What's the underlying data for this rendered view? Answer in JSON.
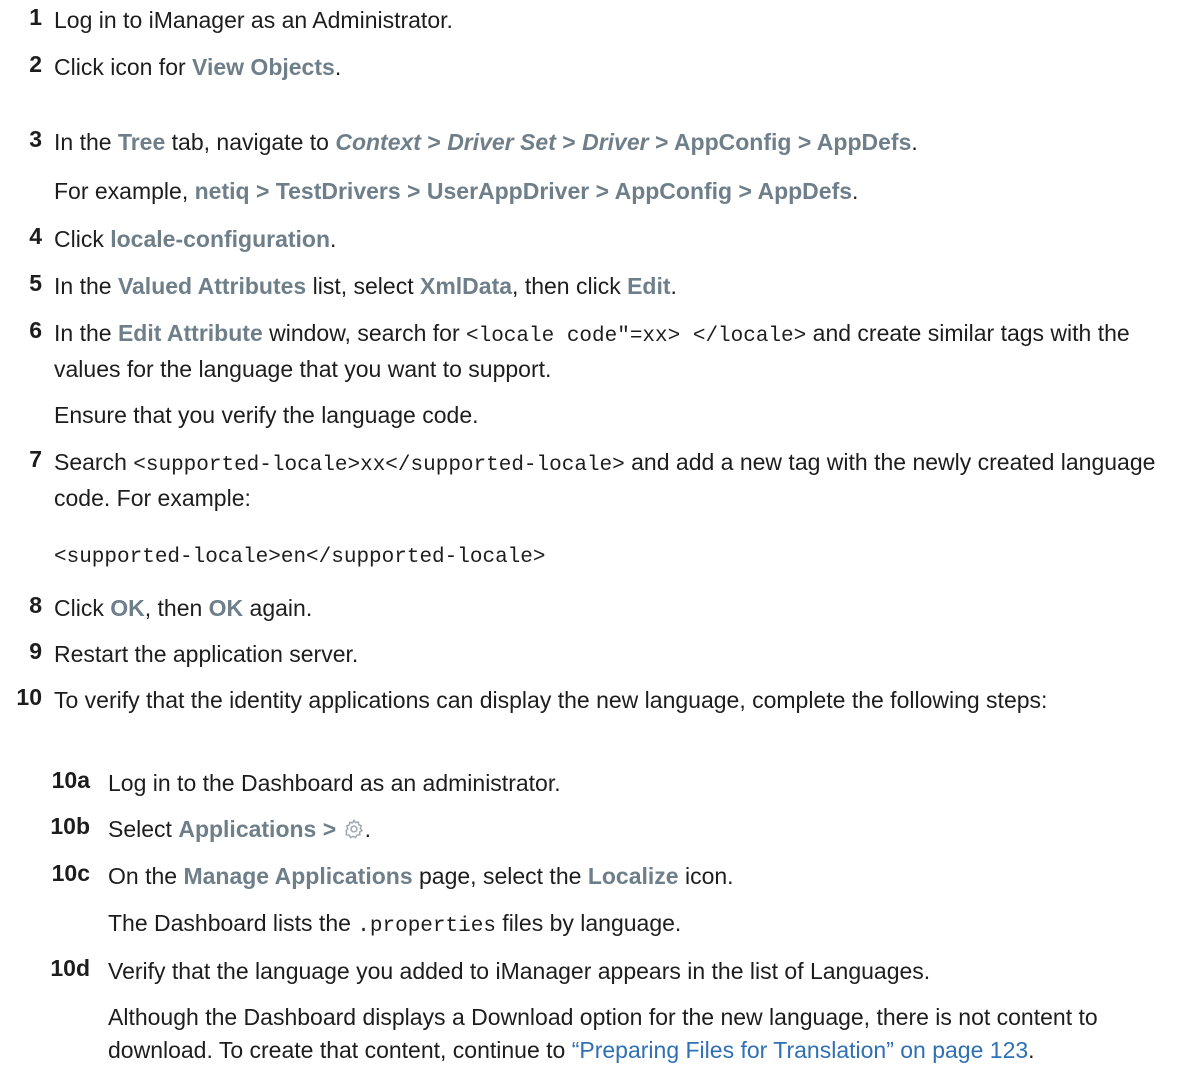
{
  "steps": [
    {
      "n": "1",
      "t0": "Log in to iManager as an Administrator."
    },
    {
      "n": "2",
      "t0": "Click icon for ",
      "ui0": "View Objects",
      "t1": "."
    },
    {
      "n": "3",
      "t0": "In the ",
      "ui0": "Tree",
      "t1": " tab, navigate to ",
      "it0": "Context",
      "s0": " > ",
      "it1": "Driver Set",
      "s1": " > ",
      "it2": "Driver",
      "s2": " > ",
      "ui1": "AppConfig",
      "s3": " > ",
      "ui2": "AppDefs",
      "t2": ".",
      "example_pre": "For example, ",
      "e0": "netiq",
      "e1": "TestDrivers",
      "e2": "UserAppDriver",
      "e3": "AppConfig",
      "e4": "AppDefs",
      "sep": " > ",
      "example_post": "."
    },
    {
      "n": "4",
      "t0": "Click ",
      "ui0": "locale-configuration",
      "t1": "."
    },
    {
      "n": "5",
      "t0": "In the ",
      "ui0": "Valued Attributes",
      "t1": " list, select ",
      "ui1": "XmlData",
      "t2": ", then click ",
      "ui2": "Edit",
      "t3": "."
    },
    {
      "n": "6",
      "t0": "In the ",
      "ui0": "Edit Attribute",
      "t1": " window, search for ",
      "code0": "<locale code\"=xx> </locale>",
      "t2": " and create similar tags with the values for the language that you want to support.",
      "note": "Ensure that you verify the language code."
    },
    {
      "n": "7",
      "t0": "Search ",
      "code0": "<supported-locale>xx</supported-locale>",
      "t1": " and add a new tag with the newly created language code. For example:",
      "code_block": "<supported-locale>en</supported-locale>"
    },
    {
      "n": "8",
      "t0": "Click ",
      "ui0": "OK",
      "t1": ", then ",
      "ui1": "OK",
      "t2": " again."
    },
    {
      "n": "9",
      "t0": "Restart the application server."
    },
    {
      "n": "10",
      "t0": "To verify that the identity applications can display the new language, complete the following steps:"
    }
  ],
  "substeps": [
    {
      "n": "10a",
      "t0": "Log in to the Dashboard as an administrator."
    },
    {
      "n": "10b",
      "t0": "Select ",
      "ui0": "Applications",
      "s0": " > ",
      "t1": "."
    },
    {
      "n": "10c",
      "t0": "On the ",
      "ui0": "Manage Applications",
      "t1": " page, select the ",
      "ui1": "Localize",
      "t2": " icon.",
      "note_pre": "The Dashboard lists the ",
      "note_code": ".properties",
      "note_post": " files by language."
    },
    {
      "n": "10d",
      "t0": "Verify that the language you added to iManager appears in the list of Languages.",
      "note": "Although the Dashboard displays a Download option for the new language, there is not content to download. To create that content, continue to ",
      "link": "“Preparing Files for Translation” on page 123",
      "note_post": "."
    }
  ],
  "icons": {
    "settings": "gear-icon"
  },
  "colors": {
    "ui_text": "#6f7f8a",
    "link": "#2f6fb4",
    "body": "#1d1d1d"
  }
}
